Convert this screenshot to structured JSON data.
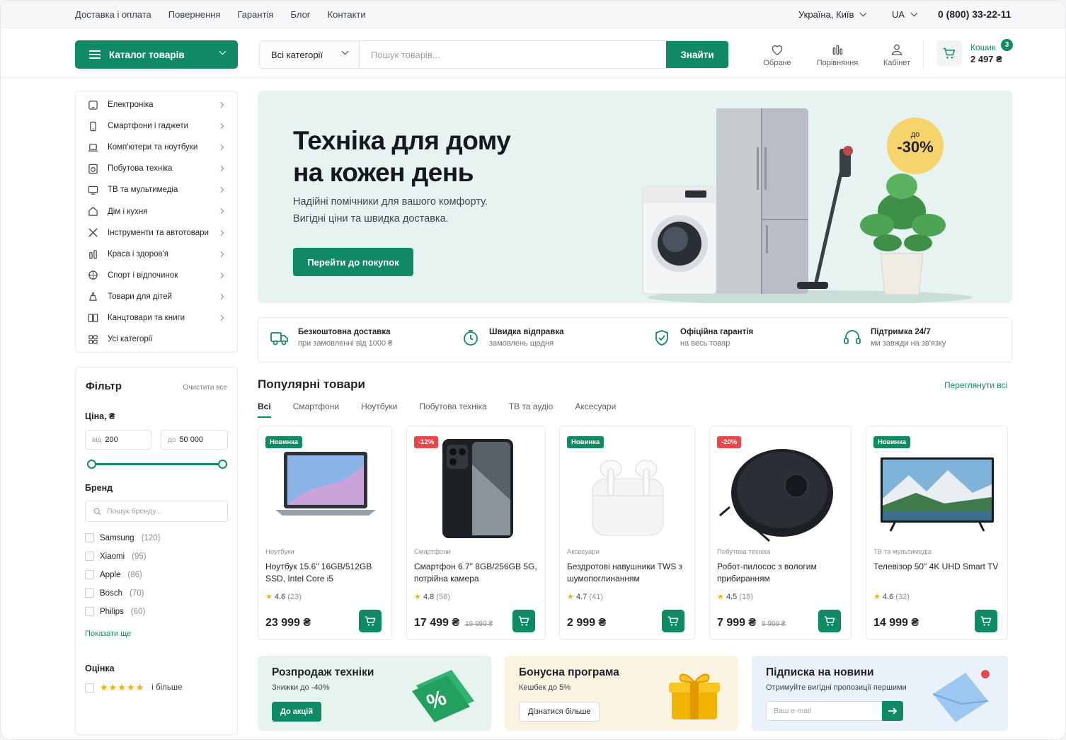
{
  "topbar": {
    "links": [
      "Доставка і оплата",
      "Повернення",
      "Гарантія",
      "Блог",
      "Контакти"
    ],
    "region": "Україна, Київ",
    "lang": "UA",
    "phone": "0 (800) 33-22-11"
  },
  "header": {
    "catalog": "Каталог товарів",
    "search_category": "Всі категорії",
    "search_placeholder": "Пошук товарів...",
    "search_button": "Знайти",
    "favorites": "Обране",
    "compare": "Порівняння",
    "account": "Кабінет",
    "cart_label": "Кошик",
    "cart_sum": "2 497 ₴",
    "cart_count": "3"
  },
  "sidebar": {
    "categories": [
      {
        "label": "Електроніка",
        "icon": "tablet-icon"
      },
      {
        "label": "Смартфони і гаджети",
        "icon": "smartphone-icon"
      },
      {
        "label": "Комп'ютери та ноутбуки",
        "icon": "laptop-icon"
      },
      {
        "label": "Побутова техніка",
        "icon": "washer-icon"
      },
      {
        "label": "ТВ та мультимедіа",
        "icon": "tv-icon"
      },
      {
        "label": "Дім і кухня",
        "icon": "home-icon"
      },
      {
        "label": "Інструменти та автотовари",
        "icon": "tools-icon"
      },
      {
        "label": "Краса і здоров'я",
        "icon": "beauty-icon"
      },
      {
        "label": "Спорт і відпочинок",
        "icon": "ball-icon"
      },
      {
        "label": "Товари для дітей",
        "icon": "toy-icon"
      },
      {
        "label": "Канцтовари та книги",
        "icon": "book-icon"
      },
      {
        "label": "Усі категорії",
        "icon": "grid-icon"
      }
    ]
  },
  "filter": {
    "title": "Фільтр",
    "clear": "Очистити все",
    "price_label": "Ціна, ₴",
    "price_from_prefix": "від",
    "price_from": "200",
    "price_to_prefix": "до",
    "price_to": "50 000",
    "brand_label": "Бренд",
    "brand_search_placeholder": "Пошук бренду...",
    "brands": [
      {
        "name": "Samsung",
        "count": "(120)"
      },
      {
        "name": "Xiaomi",
        "count": "(95)"
      },
      {
        "name": "Apple",
        "count": "(86)"
      },
      {
        "name": "Bosch",
        "count": "(70)"
      },
      {
        "name": "Philips",
        "count": "(60)"
      }
    ],
    "show_more": "Показати ще",
    "rating_label": "Оцінка",
    "rating_stars": "★★★★★",
    "rating_suffix": "і більше"
  },
  "hero": {
    "title_line1": "Техніка для дому",
    "title_line2": "на кожен день",
    "text_line1": "Надійні помічники для вашого комфорту.",
    "text_line2": "Вигідні ціни та швидка доставка.",
    "cta": "Перейти до покупок",
    "badge_top": "до",
    "badge_value": "-30%"
  },
  "features": [
    {
      "title": "Безкоштовна доставка",
      "sub": "при замовленні від 1000 ₴",
      "icon": "truck-icon"
    },
    {
      "title": "Швидка відправка",
      "sub": "замовлень щодня",
      "icon": "stopwatch-icon"
    },
    {
      "title": "Офіційна гарантія",
      "sub": "на весь товар",
      "icon": "shield-icon"
    },
    {
      "title": "Підтримка 24/7",
      "sub": "ми завжди на зв'язку",
      "icon": "headset-icon"
    }
  ],
  "popular": {
    "title": "Популярні товари",
    "see_all": "Переглянути всі",
    "tabs": [
      "Всі",
      "Смартфони",
      "Ноутбуки",
      "Побутова техніка",
      "ТВ та аудіо",
      "Аксесуари"
    ],
    "products": [
      {
        "tag": "Новинка",
        "tag_color": "#108a64",
        "category": "Ноутбуки",
        "name": "Ноутбук 15.6\" 16GB/512GB SSD, Intel Core i5",
        "rating": "4.6",
        "reviews": "(23)",
        "price": "23 999 ₴",
        "old_price": ""
      },
      {
        "tag": "-12%",
        "tag_color": "#e5484d",
        "category": "Смартфони",
        "name": "Смартфон 6.7\" 8GB/256GB 5G, потрійна камера",
        "rating": "4.8",
        "reviews": "(56)",
        "price": "17 499 ₴",
        "old_price": "19 999 ₴"
      },
      {
        "tag": "Новинка",
        "tag_color": "#108a64",
        "category": "Аксесуари",
        "name": "Бездротові навушники TWS з шумопоглинанням",
        "rating": "4.7",
        "reviews": "(41)",
        "price": "2 999 ₴",
        "old_price": ""
      },
      {
        "tag": "-20%",
        "tag_color": "#e5484d",
        "category": "Побутова техніка",
        "name": "Робот-пилосос з вологим прибиранням",
        "rating": "4.5",
        "reviews": "(18)",
        "price": "7 999 ₴",
        "old_price": "9 999 ₴"
      },
      {
        "tag": "Новинка",
        "tag_color": "#108a64",
        "category": "ТВ та мультимедіа",
        "name": "Телевізор 50\" 4K UHD Smart TV",
        "rating": "4.6",
        "reviews": "(32)",
        "price": "14 999 ₴",
        "old_price": ""
      }
    ]
  },
  "promos": [
    {
      "title": "Розпродаж техніки",
      "sub": "Знижки до -40%",
      "button": "До акцій"
    },
    {
      "title": "Бонусна програма",
      "sub": "Кешбек до 5%",
      "button": "Дізнатися більше"
    },
    {
      "title": "Підписка на новини",
      "sub": "Отримуйте вигідні пропозиції першими",
      "placeholder": "Ваш e-mail"
    }
  ],
  "colors": {
    "accent": "#108a64",
    "sale": "#e5484d",
    "hero_bg": "#e6f3f1",
    "badge": "#f6d36b"
  }
}
